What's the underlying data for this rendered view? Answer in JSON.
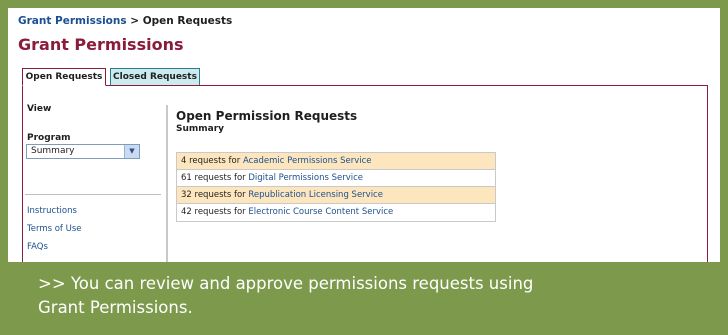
{
  "breadcrumb": {
    "link": "Grant Permissions",
    "separator": ">",
    "current": "Open Requests"
  },
  "page_title": "Grant Permissions",
  "tabs": [
    {
      "label": "Open Requests",
      "active": true
    },
    {
      "label": "Closed Requests",
      "active": false
    }
  ],
  "sidebar": {
    "view_label": "View",
    "program_label": "Program",
    "program_value": "Summary",
    "links": [
      "Instructions",
      "Terms of Use",
      "FAQs"
    ]
  },
  "main": {
    "heading": "Open Permission Requests",
    "subheading": "Summary",
    "requests": [
      {
        "count_text": "4 requests for",
        "service": "Academic Permissions Service",
        "highlight": true
      },
      {
        "count_text": "61 requests for",
        "service": "Digital Permissions Service",
        "highlight": false
      },
      {
        "count_text": "32 requests for",
        "service": "Republication Licensing Service",
        "highlight": true
      },
      {
        "count_text": "42 requests for",
        "service": "Electronic Course Content Service",
        "highlight": false
      }
    ]
  },
  "caption": {
    "line1": ">> You can review and approve permissions requests using",
    "line2": "Grant Permissions."
  },
  "colors": {
    "frame_green": "#7d9a4c",
    "title_maroon": "#8a1b3b",
    "link_blue": "#1c4f8f",
    "row_highlight": "#fde6bd",
    "closed_tab": "#ccebef"
  }
}
